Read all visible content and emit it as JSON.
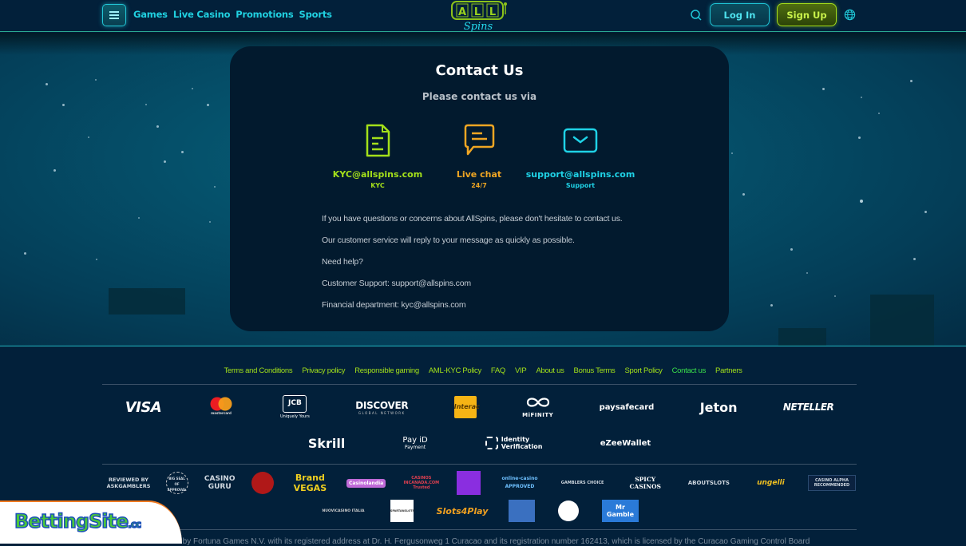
{
  "header": {
    "nav": [
      "Games",
      "Live Casino",
      "Promotions",
      "Sports"
    ],
    "logo_top": "ALL",
    "logo_bottom": "Spins",
    "login_label": "Log In",
    "signup_label": "Sign Up",
    "colors": {
      "accent_cyan": "#20d0e0",
      "accent_green": "#a4dd1a"
    }
  },
  "contact": {
    "title": "Contact Us",
    "subtitle": "Please contact us via",
    "methods": [
      {
        "icon": "document-icon",
        "value": "KYC@allspins.com",
        "label": "KYC",
        "color": "#a4e01a"
      },
      {
        "icon": "chat-bubble-icon",
        "value": "Live chat",
        "label": "24/7",
        "color": "#f0a623"
      },
      {
        "icon": "envelope-icon",
        "value": "support@allspins.com",
        "label": "Support",
        "color": "#1fd2e6"
      }
    ],
    "lines": [
      "If you have questions or concerns about AllSpins, please don't hesitate to contact us.",
      "Our customer service will reply to your message as quickly as possible.",
      "Need help?",
      "Customer Support: support@allspins.com",
      "Financial department: kyc@allspins.com"
    ]
  },
  "footer": {
    "links": [
      "Terms and Conditions",
      "Privacy policy",
      "Responsible gaming",
      "AML-KYC Policy",
      "FAQ",
      "VIP",
      "About us",
      "Bonus Terms",
      "Sport Policy",
      "Contact us",
      "Partners"
    ],
    "active_link": "Contact us",
    "payments_row1": [
      "VISA",
      "mastercard",
      "JCB",
      "DISCOVER",
      "Interac",
      "MiFINITY",
      "paysafecard",
      "Jeton",
      "NETELLER"
    ],
    "payments_row1_sub": {
      "JCB": "Uniquely Yours",
      "DISCOVER": "GLOBAL NETWORK"
    },
    "payments_row2": [
      "Skrill",
      "Pay iD",
      "Identity Verification",
      "eZeeWallet"
    ],
    "payments_row2_sub": {
      "Pay iD": "Payment"
    },
    "seals_row1": [
      "REVIEWED BY ASKGAMBLERS",
      "BIG SEAL OF APPROVAL",
      "CASINO GURU",
      "seal",
      "Brand VEGAS",
      "Casinolandia",
      "CASINOS INCANADA.COM Trusted",
      "avatar",
      "online-casino APPROVED",
      "GAMBLERS CHOICE",
      "SPICY CASINOS",
      "ABOUTSLOTS",
      "ungelli",
      "CASINO ALPHA RECOMMENDED"
    ],
    "seals_row2": [
      "NUOVICASINO ITALIA",
      "SPARTANSLOTS",
      "Slots4Play",
      "badge",
      "seal",
      "Mr Gamble"
    ],
    "legal": "ted by Fortuna Games N.V. with its registered address at Dr. H. Fergusonweg 1 Curacao and its registration number 162413, which is licensed by the Curacao Gaming Control Board"
  },
  "watermark": {
    "text": "BettingSite",
    "suffix": ".cc"
  }
}
